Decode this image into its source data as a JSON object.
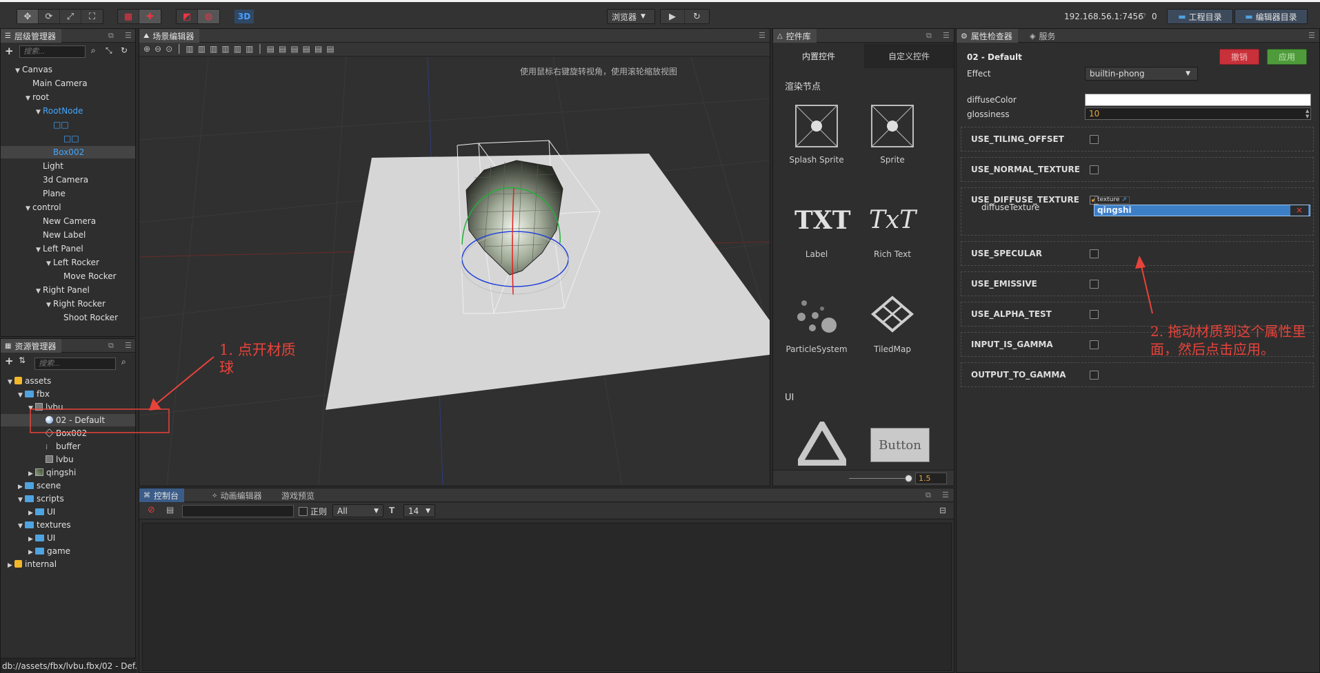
{
  "top_bar": {
    "tool_icons": [
      "move-icon",
      "rotate-icon",
      "scale-icon",
      "rect-icon"
    ],
    "mode_3d": "3D",
    "preview_select": "浏览器",
    "ip": "192.168.56.1:7456",
    "wifi_count": "0",
    "project_dir": "工程目录",
    "editor_dir": "编辑器目录"
  },
  "hierarchy": {
    "title": "层级管理器",
    "search_placeholder": "搜索...",
    "nodes": [
      {
        "label": "Canvas",
        "depth": 1,
        "arrow": true,
        "color": "normal"
      },
      {
        "label": "Main Camera",
        "depth": 2,
        "arrow": false,
        "color": "normal"
      },
      {
        "label": "root",
        "depth": 2,
        "arrow": true,
        "color": "normal"
      },
      {
        "label": "RootNode",
        "depth": 3,
        "arrow": true,
        "color": "blue"
      },
      {
        "label": "□□",
        "depth": 4,
        "arrow": false,
        "color": "blue"
      },
      {
        "label": "□□",
        "depth": 5,
        "arrow": false,
        "color": "blue"
      },
      {
        "label": "Box002",
        "depth": 4,
        "arrow": false,
        "color": "blue",
        "selected": true
      },
      {
        "label": "Light",
        "depth": 3,
        "arrow": false,
        "color": "normal"
      },
      {
        "label": "3d Camera",
        "depth": 3,
        "arrow": false,
        "color": "normal"
      },
      {
        "label": "Plane",
        "depth": 3,
        "arrow": false,
        "color": "normal"
      },
      {
        "label": "control",
        "depth": 2,
        "arrow": true,
        "color": "normal"
      },
      {
        "label": "New Camera",
        "depth": 3,
        "arrow": false,
        "color": "normal"
      },
      {
        "label": "New Label",
        "depth": 3,
        "arrow": false,
        "color": "normal"
      },
      {
        "label": "Left Panel",
        "depth": 3,
        "arrow": true,
        "color": "normal"
      },
      {
        "label": "Left Rocker",
        "depth": 4,
        "arrow": true,
        "color": "normal"
      },
      {
        "label": "Move Rocker",
        "depth": 5,
        "arrow": false,
        "color": "normal"
      },
      {
        "label": "Right Panel",
        "depth": 3,
        "arrow": true,
        "color": "normal"
      },
      {
        "label": "Right Rocker",
        "depth": 4,
        "arrow": true,
        "color": "normal"
      },
      {
        "label": "Shoot Rocker",
        "depth": 5,
        "arrow": false,
        "color": "normal"
      }
    ]
  },
  "assets": {
    "title": "资源管理器",
    "search_placeholder": "搜索...",
    "items": [
      {
        "label": "assets",
        "depth": 0,
        "arrow": "down",
        "icon": "db-icon"
      },
      {
        "label": "fbx",
        "depth": 1,
        "arrow": "down",
        "icon": "folder-icon"
      },
      {
        "label": "lvbu",
        "depth": 2,
        "arrow": "down",
        "icon": "mesh-icon"
      },
      {
        "label": "02 - Default",
        "depth": 3,
        "arrow": "none",
        "icon": "material-icon",
        "selected": true
      },
      {
        "label": "Box002",
        "depth": 3,
        "arrow": "none",
        "icon": "cube-icon"
      },
      {
        "label": "buffer",
        "depth": 3,
        "arrow": "none",
        "icon": "buffer-icon"
      },
      {
        "label": "lvbu",
        "depth": 3,
        "arrow": "none",
        "icon": "mesh-icon"
      },
      {
        "label": "qingshi",
        "depth": 2,
        "arrow": "right",
        "icon": "texture-icon"
      },
      {
        "label": "scene",
        "depth": 1,
        "arrow": "right",
        "icon": "folder-icon"
      },
      {
        "label": "scripts",
        "depth": 1,
        "arrow": "down",
        "icon": "folder-icon"
      },
      {
        "label": "UI",
        "depth": 2,
        "arrow": "right",
        "icon": "folder-icon"
      },
      {
        "label": "textures",
        "depth": 1,
        "arrow": "down",
        "icon": "folder-icon"
      },
      {
        "label": "UI",
        "depth": 2,
        "arrow": "right",
        "icon": "folder-icon"
      },
      {
        "label": "game",
        "depth": 2,
        "arrow": "right",
        "icon": "folder-icon"
      },
      {
        "label": "internal",
        "depth": 0,
        "arrow": "right",
        "icon": "db-icon"
      }
    ],
    "status_path": "db://assets/fbx/lvbu.fbx/02 - Def..."
  },
  "scene": {
    "title": "场景编辑器",
    "hint": "使用鼠标右键旋转视角，使用滚轮缩放视图"
  },
  "widgets": {
    "title": "控件库",
    "tab_builtin": "内置控件",
    "tab_custom": "自定义控件",
    "section_render": "渲染节点",
    "section_ui": "UI",
    "items": [
      {
        "label": "Splash Sprite",
        "glyph": ""
      },
      {
        "label": "Sprite",
        "glyph": ""
      },
      {
        "label": "Label",
        "glyph": "TXT"
      },
      {
        "label": "Rich Text",
        "glyph": "TxT"
      },
      {
        "label": "ParticleSystem",
        "glyph": ""
      },
      {
        "label": "TiledMap",
        "glyph": ""
      }
    ],
    "button_glyph": "Button",
    "zoom_value": "1.5"
  },
  "inspector": {
    "title": "属性检查器",
    "tab_service": "服务",
    "asset_name": "02 - Default",
    "revert": "撤销",
    "apply": "应用",
    "effect_label": "Effect",
    "effect_value": "builtin-phong",
    "diffuse_color_label": "diffuseColor",
    "diffuse_color": "#ffffff",
    "glossiness_label": "glossiness",
    "glossiness_value": "10",
    "defines": [
      {
        "label": "USE_TILING_OFFSET",
        "checked": false
      },
      {
        "label": "USE_NORMAL_TEXTURE",
        "checked": false
      },
      {
        "label": "USE_DIFFUSE_TEXTURE",
        "checked": true
      },
      {
        "label": "USE_SPECULAR",
        "checked": false
      },
      {
        "label": "USE_EMISSIVE",
        "checked": false
      },
      {
        "label": "USE_ALPHA_TEST",
        "checked": false
      },
      {
        "label": "INPUT_IS_GAMMA",
        "checked": false
      },
      {
        "label": "OUTPUT_TO_GAMMA",
        "checked": false
      }
    ],
    "diffuse_texture_label": "diffuseTexture",
    "texture_tag": "texture",
    "texture_value": "qingshi"
  },
  "console": {
    "tab_console": "控制台",
    "tab_animation": "动画编辑器",
    "tab_preview": "游戏预览",
    "regex_label": "正则",
    "level_value": "All",
    "font_size_value": "14"
  },
  "annotations": {
    "note1": "1. 点开材质球",
    "note2": "2. 拖动材质到这个属性里面，然后点击应用。"
  },
  "colors": {
    "accent_blue": "#44a6ff",
    "revert_red": "#c8303a",
    "apply_green": "#4f9b3c",
    "annotation_red": "#e8433a"
  }
}
